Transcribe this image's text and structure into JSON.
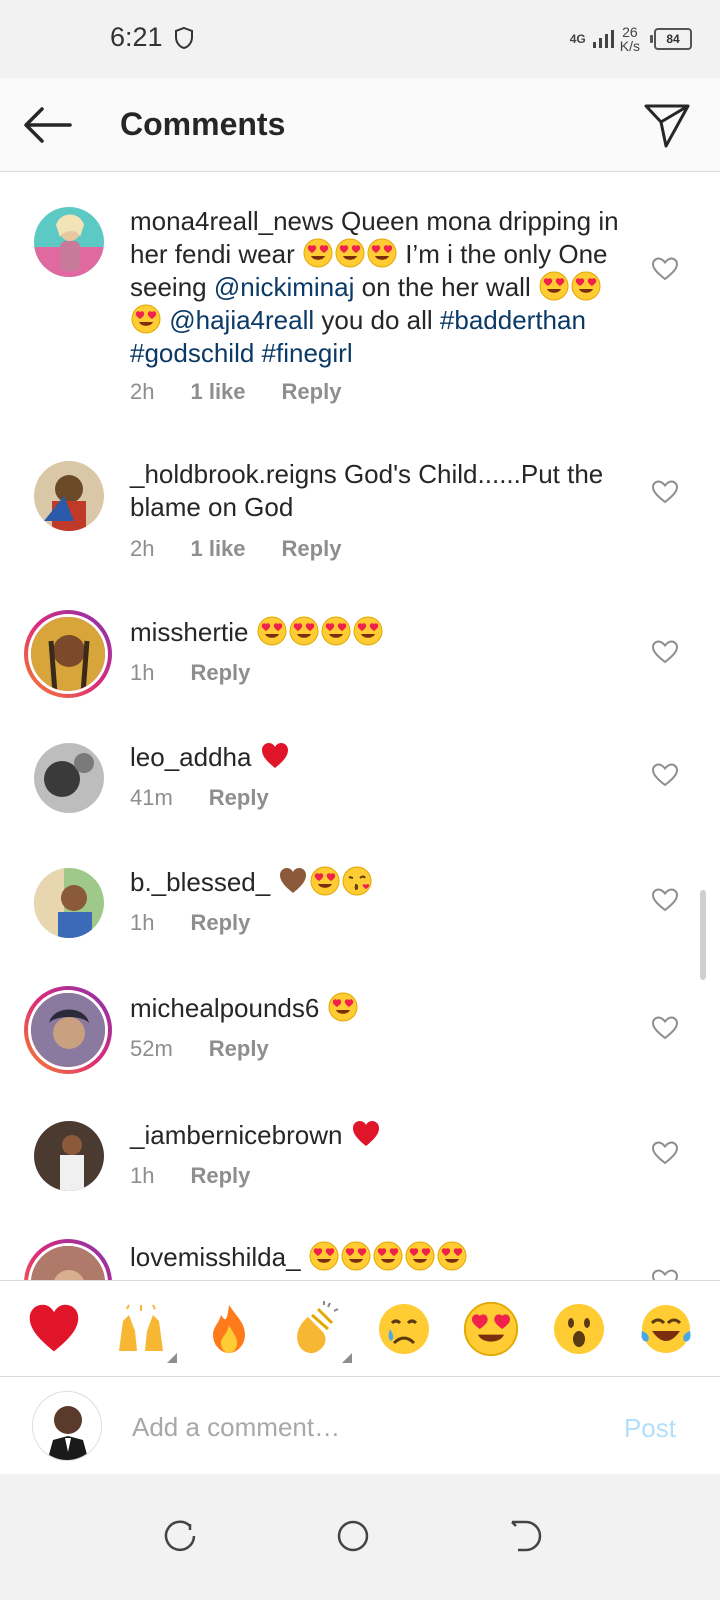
{
  "status_bar": {
    "time": "6:21",
    "network": "4G",
    "speed_value": "26",
    "speed_unit": "K/s",
    "battery": "84"
  },
  "header": {
    "title": "Comments"
  },
  "comments": [
    {
      "username": "mona4reall_news",
      "parts": [
        "Queen mona dripping in her fendi wear ",
        " I’m i the only One seeing ",
        "@nickiminaj",
        " on the her wall ",
        " ",
        "@hajia4reall",
        " you do all ",
        "#badderthan",
        " ",
        "#godschild",
        " ",
        "#finegirl"
      ],
      "time": "2h",
      "likes": "1 like",
      "reply": "Reply"
    },
    {
      "username": "_holdbrook.reigns",
      "text": "God's Child......Put the blame on God",
      "time": "2h",
      "likes": "1 like",
      "reply": "Reply"
    },
    {
      "username": "misshertie",
      "time": "1h",
      "reply": "Reply"
    },
    {
      "username": "leo_addha",
      "time": "41m",
      "reply": "Reply"
    },
    {
      "username": "b._blessed_",
      "time": "1h",
      "reply": "Reply"
    },
    {
      "username": "michealpounds6",
      "time": "52m",
      "reply": "Reply"
    },
    {
      "username": "_iambernicebrown",
      "time": "1h",
      "reply": "Reply"
    },
    {
      "username": "lovemisshilda_"
    }
  ],
  "reactions": [
    "red-heart",
    "raising-hands",
    "fire",
    "clapping-hands",
    "crying-face",
    "heart-eyes",
    "surprised-face",
    "tears-of-joy"
  ],
  "input": {
    "placeholder": "Add a comment…",
    "post_label": "Post"
  },
  "colors": {
    "link": "#0b3a66",
    "post_disabled": "#b2dffc",
    "muted": "#8e8e8e"
  }
}
